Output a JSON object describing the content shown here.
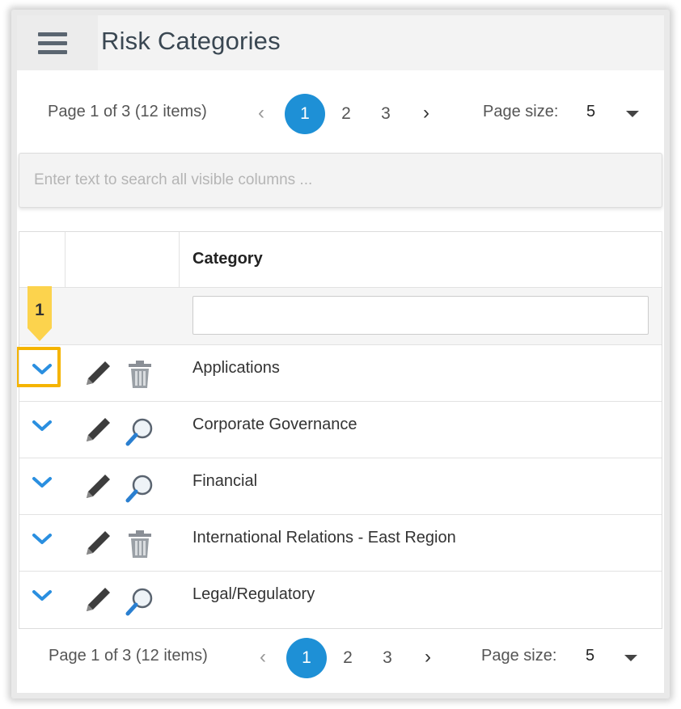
{
  "header": {
    "title": "Risk Categories",
    "menu_icon": "hamburger-menu-icon"
  },
  "pager": {
    "summary": "Page 1 of 3 (12 items)",
    "prev_icon": "chevron-left-icon",
    "next_icon": "chevron-right-icon",
    "pages": [
      "1",
      "2",
      "3"
    ],
    "active_page": "1",
    "page_size_label": "Page size:",
    "page_size_value": "5"
  },
  "search": {
    "placeholder": "Enter text to search all visible columns ..."
  },
  "grid": {
    "column_header": "Category",
    "filter_value": "",
    "rows": [
      {
        "category": "Applications",
        "action_icon": "trash-icon"
      },
      {
        "category": "Corporate Governance",
        "action_icon": "magnifier-icon"
      },
      {
        "category": "Financial",
        "action_icon": "magnifier-icon"
      },
      {
        "category": "International Relations - East Region",
        "action_icon": "trash-icon"
      },
      {
        "category": "Legal/Regulatory",
        "action_icon": "magnifier-icon"
      }
    ]
  },
  "callout": {
    "label": "1"
  },
  "colors": {
    "accent": "#1e90d6",
    "callout": "#fcd34d",
    "highlight": "#f5b400",
    "title": "#3a4752"
  }
}
